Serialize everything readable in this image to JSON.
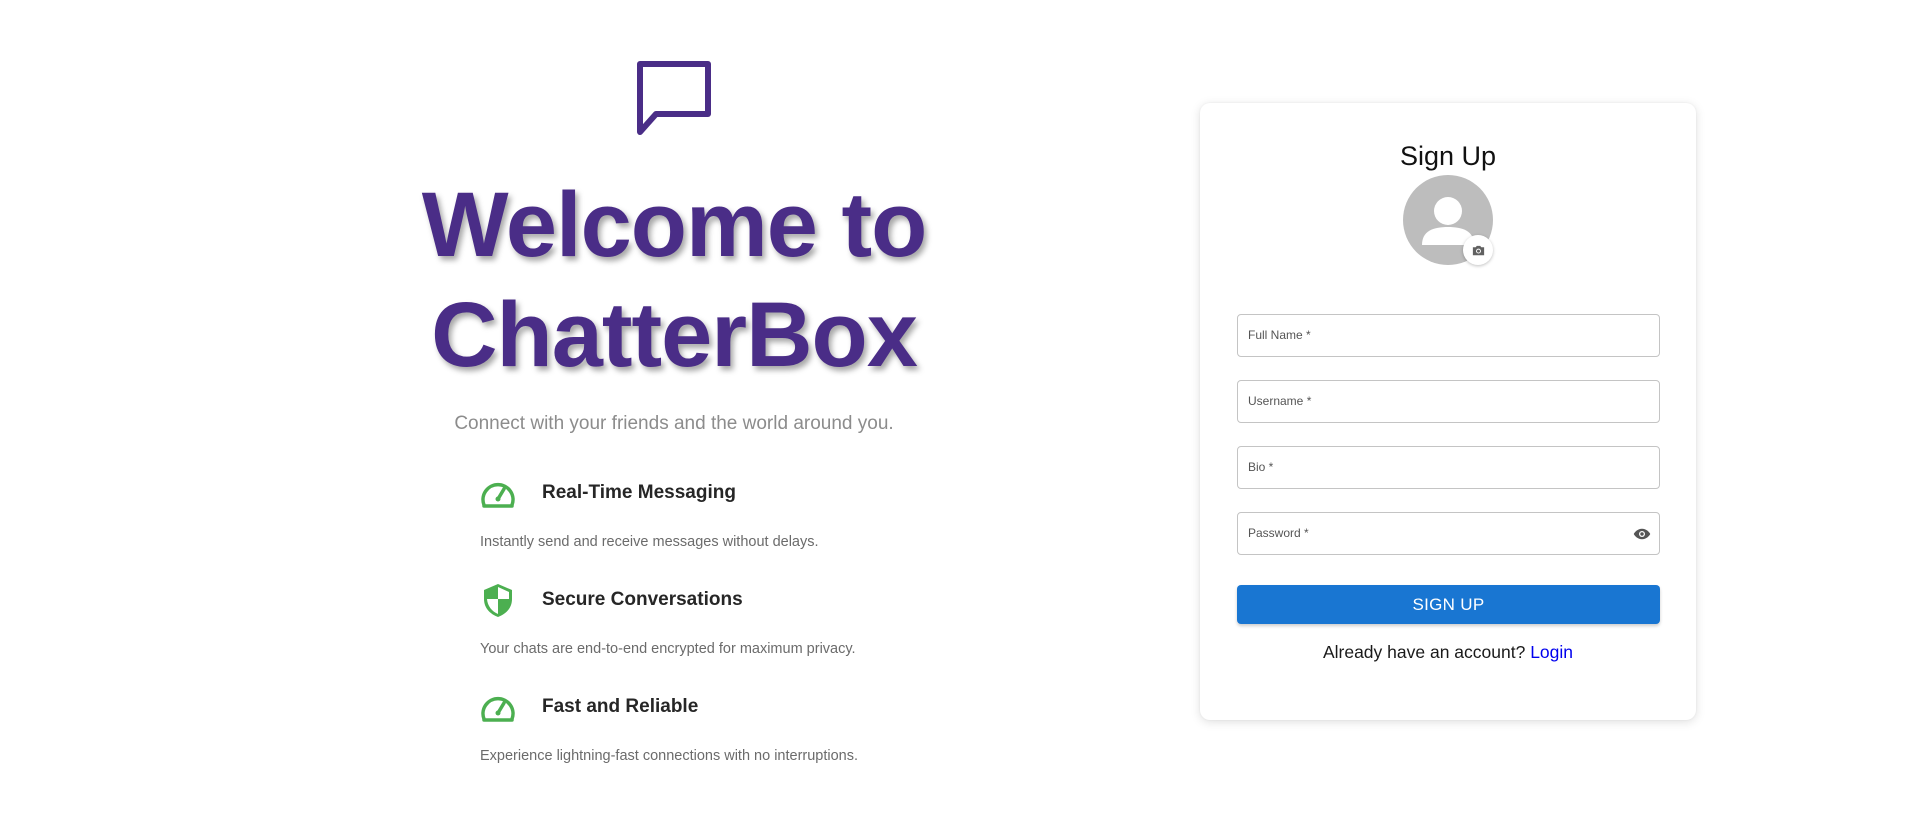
{
  "hero": {
    "title": "Welcome to ChatterBox",
    "subtitle": "Connect with your friends and the world around you.",
    "brand_icon": "chat-bubble-icon",
    "brand_color": "#4a2d87",
    "features": [
      {
        "icon": "speed-gauge-icon",
        "title": "Real-Time Messaging",
        "description": "Instantly send and receive messages without delays."
      },
      {
        "icon": "shield-icon",
        "title": "Secure Conversations",
        "description": "Your chats are end-to-end encrypted for maximum privacy."
      },
      {
        "icon": "speed-gauge-icon",
        "title": "Fast and Reliable",
        "description": "Experience lightning-fast connections with no interruptions."
      }
    ],
    "feature_icon_color": "#4caf50"
  },
  "signup": {
    "title": "Sign Up",
    "avatar_icon": "person-icon",
    "camera_icon": "camera-icon",
    "fields": {
      "full_name": {
        "label": "Full Name *",
        "value": ""
      },
      "username": {
        "label": "Username *",
        "value": ""
      },
      "bio": {
        "label": "Bio *",
        "value": ""
      },
      "password": {
        "label": "Password *",
        "value": "",
        "toggle_icon": "eye-icon"
      }
    },
    "submit_label": "SIGN UP",
    "submit_color": "#1976d2",
    "login_prompt": "Already have an account?",
    "login_link": "Login"
  }
}
